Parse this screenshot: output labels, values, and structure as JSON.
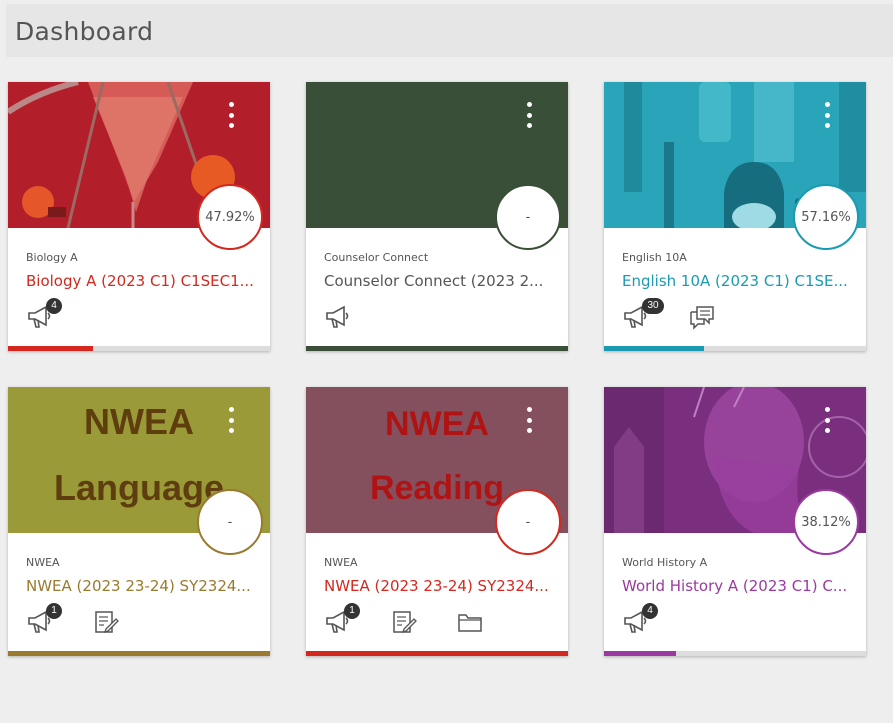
{
  "header": {
    "title": "Dashboard"
  },
  "cards": [
    {
      "short": "Biology A",
      "title": "Biology A (2023 C1) C1SEC1...",
      "grade": "47.92%",
      "color": "#d4281f",
      "progress": 0.33,
      "announcements_badge": "4"
    },
    {
      "short": "Counselor Connect",
      "title": "Counselor Connect (2023 2...",
      "grade": "-",
      "color": "#3a4f37",
      "progress": 1.0
    },
    {
      "short": "English 10A",
      "title": "English 10A (2023 C1) C1SE...",
      "grade": "57.16%",
      "color": "#1a9bb3",
      "progress": 0.38,
      "announcements_badge": "30"
    },
    {
      "short": "NWEA",
      "title": "NWEA (2023 23-24) SY2324...",
      "grade": "-",
      "color": "#9a7a2e",
      "progress": 1.0,
      "announcements_badge": "1",
      "image_text": [
        "NWEA",
        "Language"
      ]
    },
    {
      "short": "NWEA",
      "title": "NWEA (2023 23-24) SY2324...",
      "grade": "-",
      "color": "#d4281f",
      "progress": 1.0,
      "announcements_badge": "1",
      "image_text": [
        "NWEA",
        "Reading"
      ]
    },
    {
      "short": "World History A",
      "title": "World History A (2023 C1) C...",
      "grade": "38.12%",
      "color": "#9a3aa0",
      "progress": 0.28,
      "announcements_badge": "4"
    }
  ]
}
